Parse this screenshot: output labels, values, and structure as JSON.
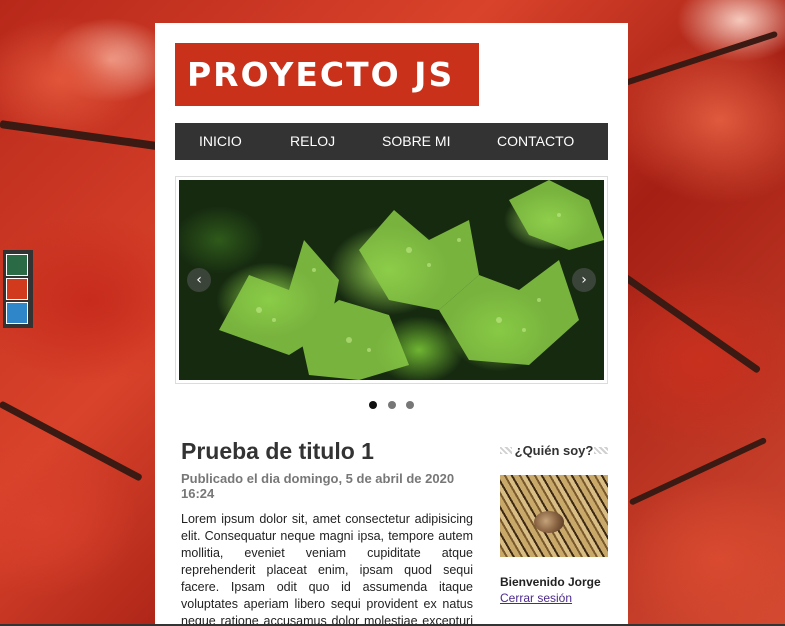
{
  "site": {
    "logo_text": "PROYECTO JS"
  },
  "nav": {
    "items": [
      {
        "label": "INICIO"
      },
      {
        "label": "RELOJ"
      },
      {
        "label": "SOBRE MI"
      },
      {
        "label": "CONTACTO"
      }
    ]
  },
  "slider": {
    "prev_icon": "‹",
    "next_icon": "›",
    "active_dot": 0,
    "dot_count": 3
  },
  "article": {
    "title": "Prueba de titulo 1",
    "date": "Publicado el dia domingo, 5 de abril de 2020 16:24",
    "body": "Lorem ipsum dolor sit, amet consectetur adipisicing elit. Consequatur neque magni ipsa, tempore autem mollitia, eveniet veniam cupiditate atque reprehenderit placeat enim, ipsam quod sequi facere. Ipsam odit quo id assumenda itaque voluptates aperiam libero sequi provident ex natus neque ratione accusamus dolor molestiae excepturi deleniti quam, harum molestias dicta?"
  },
  "sidebar": {
    "title": "¿Quién soy?",
    "welcome": "Bienvenido Jorge",
    "logout": "Cerrar sesión"
  },
  "theme_swatches": {
    "colors": [
      "#2a6b45",
      "#d23a1e",
      "#2f86c9"
    ]
  }
}
